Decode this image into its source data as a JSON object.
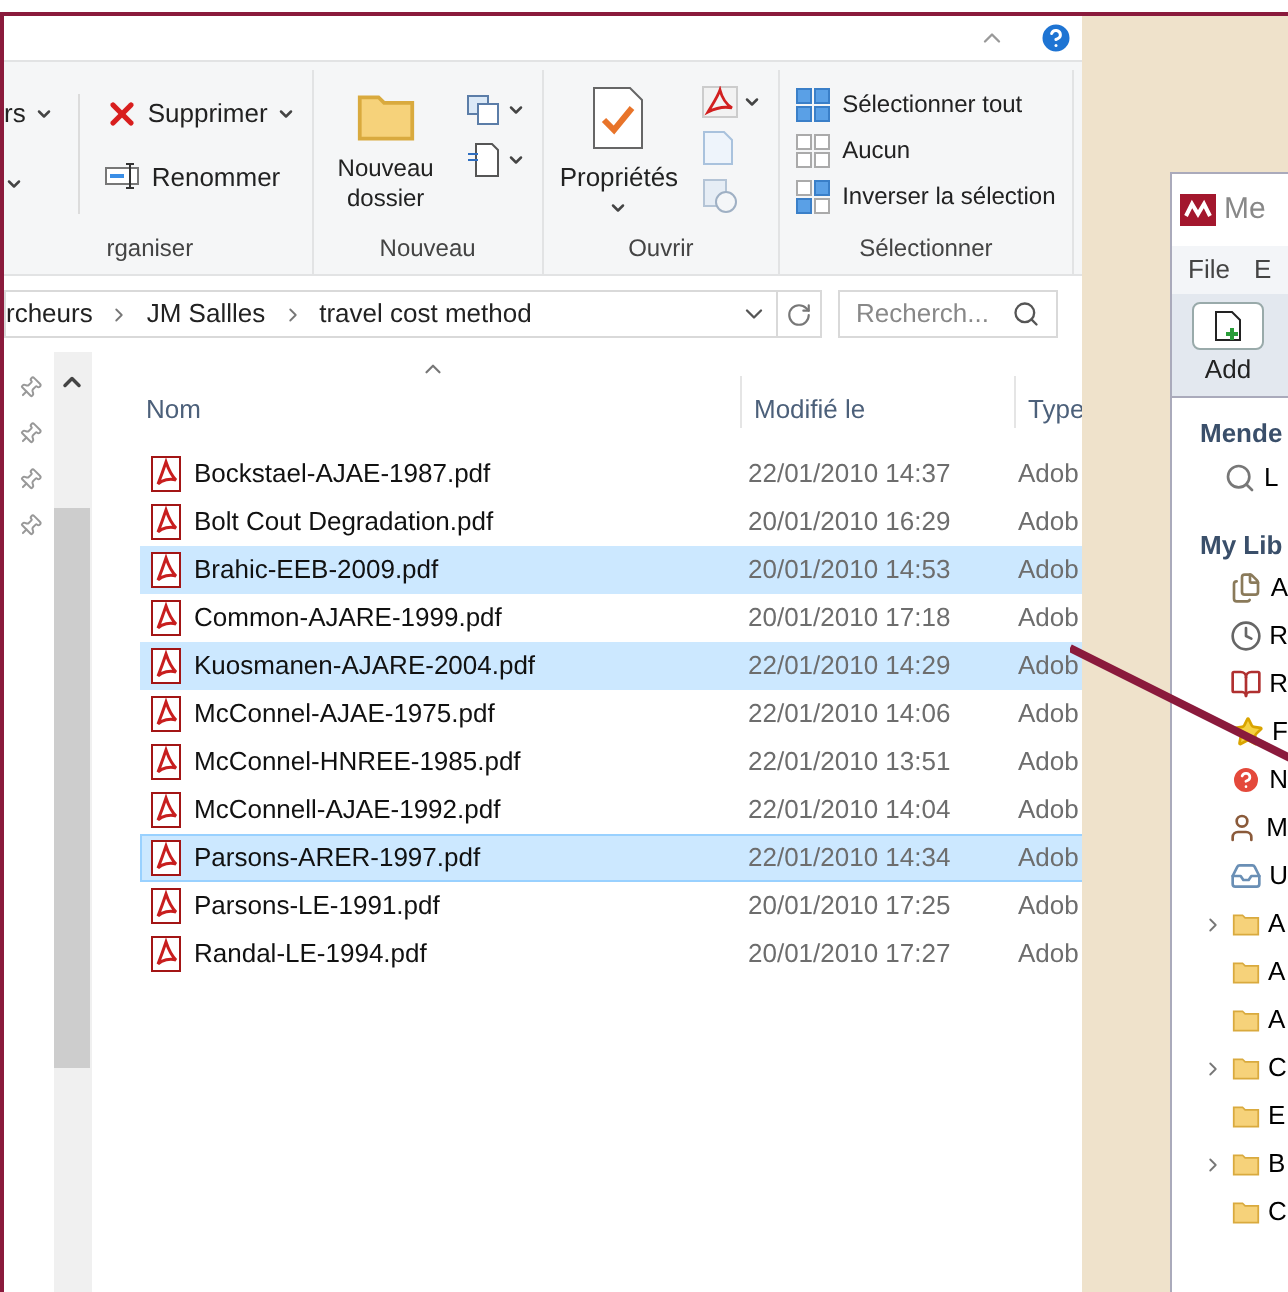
{
  "ribbon": {
    "groups": [
      {
        "kind": "organise",
        "label": "rganiser",
        "items": [
          {
            "label": "rs"
          },
          {
            "label": "Supprimer"
          },
          {
            "label": "Renommer"
          }
        ]
      },
      {
        "kind": "new",
        "label": "Nouveau",
        "items": [
          {
            "label": "Nouveau dossier"
          }
        ]
      },
      {
        "kind": "open",
        "label": "Ouvrir",
        "items": [
          {
            "label": "Propriétés"
          }
        ]
      },
      {
        "kind": "select",
        "label": "Sélectionner",
        "items": [
          {
            "label": "Sélectionner tout"
          },
          {
            "label": "Aucun"
          },
          {
            "label": "Inverser la sélection"
          }
        ]
      }
    ]
  },
  "address": {
    "path": [
      "rcheurs",
      "JM Sallles",
      "travel cost method"
    ],
    "search_placeholder": "Recherch..."
  },
  "columns": [
    "Nom",
    "Modifié le",
    "Type"
  ],
  "files": [
    {
      "name": "Bockstael-AJAE-1987.pdf",
      "modified": "22/01/2010 14:37",
      "type": "Adob",
      "selected": false,
      "focused": false
    },
    {
      "name": "Bolt Cout Degradation.pdf",
      "modified": "20/01/2010 16:29",
      "type": "Adob",
      "selected": false,
      "focused": false
    },
    {
      "name": "Brahic-EEB-2009.pdf",
      "modified": "20/01/2010 14:53",
      "type": "Adob",
      "selected": true,
      "focused": false
    },
    {
      "name": "Common-AJARE-1999.pdf",
      "modified": "20/01/2010 17:18",
      "type": "Adob",
      "selected": false,
      "focused": false
    },
    {
      "name": "Kuosmanen-AJARE-2004.pdf",
      "modified": "22/01/2010 14:29",
      "type": "Adob",
      "selected": true,
      "focused": false
    },
    {
      "name": "McConnel-AJAE-1975.pdf",
      "modified": "22/01/2010 14:06",
      "type": "Adob",
      "selected": false,
      "focused": false
    },
    {
      "name": "McConnel-HNREE-1985.pdf",
      "modified": "22/01/2010 13:51",
      "type": "Adob",
      "selected": false,
      "focused": false
    },
    {
      "name": "McConnell-AJAE-1992.pdf",
      "modified": "22/01/2010 14:04",
      "type": "Adob",
      "selected": false,
      "focused": false
    },
    {
      "name": "Parsons-ARER-1997.pdf",
      "modified": "22/01/2010 14:34",
      "type": "Adob",
      "selected": true,
      "focused": true
    },
    {
      "name": "Parsons-LE-1991.pdf",
      "modified": "20/01/2010 17:25",
      "type": "Adob",
      "selected": false,
      "focused": false
    },
    {
      "name": "Randal-LE-1994.pdf",
      "modified": "20/01/2010 17:27",
      "type": "Adob",
      "selected": false,
      "focused": false
    }
  ],
  "mendeley": {
    "title": "Me",
    "menu": [
      "File",
      "E"
    ],
    "toolbar": [
      "Add"
    ],
    "section_1": {
      "label": "Mende",
      "items": [
        {
          "kind": "search",
          "label": "L"
        }
      ]
    },
    "section_2": {
      "label": "My Lib",
      "items": [
        {
          "kind": "documents",
          "label": "A"
        },
        {
          "kind": "recent",
          "label": "R"
        },
        {
          "kind": "reading",
          "label": "R"
        },
        {
          "kind": "favorites",
          "label": "F"
        },
        {
          "kind": "review",
          "label": "N"
        },
        {
          "kind": "author",
          "label": "M"
        },
        {
          "kind": "unsorted",
          "label": "U"
        },
        {
          "kind": "folder",
          "label": "A",
          "has_children": true
        },
        {
          "kind": "folder",
          "label": "A",
          "has_children": false
        },
        {
          "kind": "folder",
          "label": "A",
          "has_children": false
        },
        {
          "kind": "folder",
          "label": "C",
          "has_children": true
        },
        {
          "kind": "folder",
          "label": "E",
          "has_children": false
        },
        {
          "kind": "folder",
          "label": "B",
          "has_children": true
        },
        {
          "kind": "folder",
          "label": "C",
          "has_children": false
        }
      ]
    }
  }
}
